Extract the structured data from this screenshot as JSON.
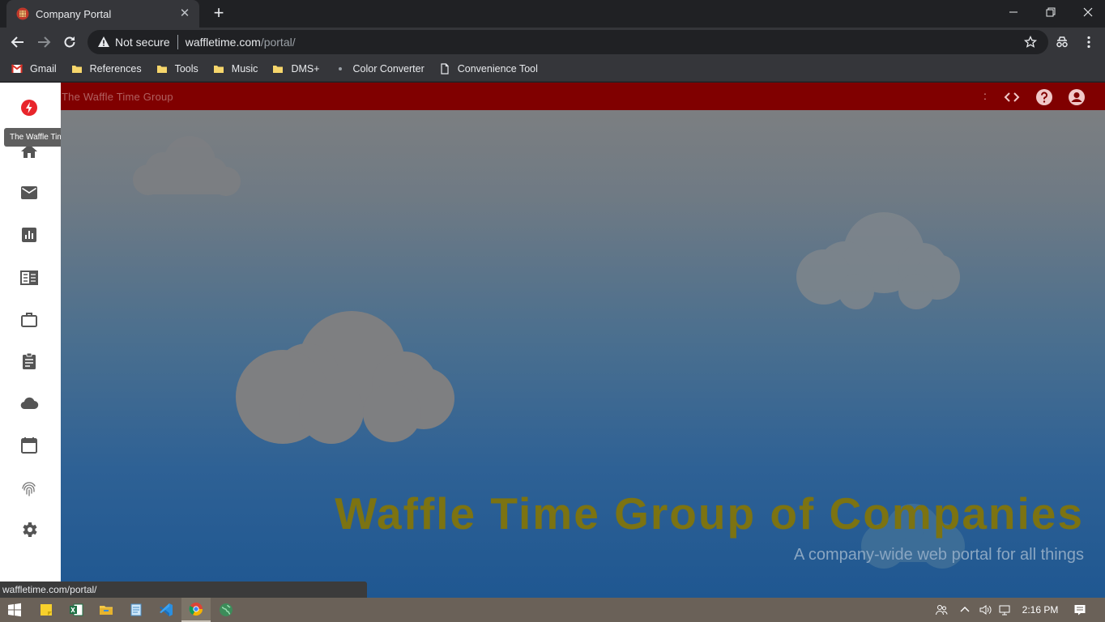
{
  "browser": {
    "tab": {
      "title": "Company Portal"
    },
    "address": {
      "security": "Not secure",
      "host": "waffletime.com",
      "path": "/portal/"
    },
    "bookmarks": [
      {
        "label": "Gmail",
        "icon": "gmail-icon"
      },
      {
        "label": "References",
        "icon": "folder-icon"
      },
      {
        "label": "Tools",
        "icon": "folder-icon"
      },
      {
        "label": "Music",
        "icon": "folder-icon"
      },
      {
        "label": "DMS+",
        "icon": "folder-icon"
      },
      {
        "label": "Color Converter",
        "icon": "dot-icon"
      },
      {
        "label": "Convenience Tool",
        "icon": "page-icon"
      }
    ],
    "status_url": "waffletime.com/portal/"
  },
  "portal": {
    "topbar_title": "The Waffle Time Group",
    "topbar_colon": ":",
    "tooltip": "The Waffle Time Group",
    "hero_title": "Waffle Time Group of Companies",
    "hero_subtitle": "A company-wide web portal for all things",
    "sidebar_icons": [
      "bolt-icon",
      "home-icon",
      "mail-icon",
      "chart-icon",
      "news-icon",
      "briefcase-icon",
      "clipboard-icon",
      "cloud-icon",
      "calendar-icon",
      "fingerprint-icon",
      "settings-icon"
    ],
    "colors": {
      "topbar": "#800000",
      "brand": "#e8252b",
      "hero_title": "#7c7312"
    }
  },
  "taskbar": {
    "time": "2:16 PM",
    "apps": [
      "windows-start-icon",
      "sticky-notes-icon",
      "excel-icon",
      "file-explorer-icon",
      "notepad-icon",
      "vscode-icon",
      "chrome-icon",
      "globe-app-icon"
    ]
  }
}
